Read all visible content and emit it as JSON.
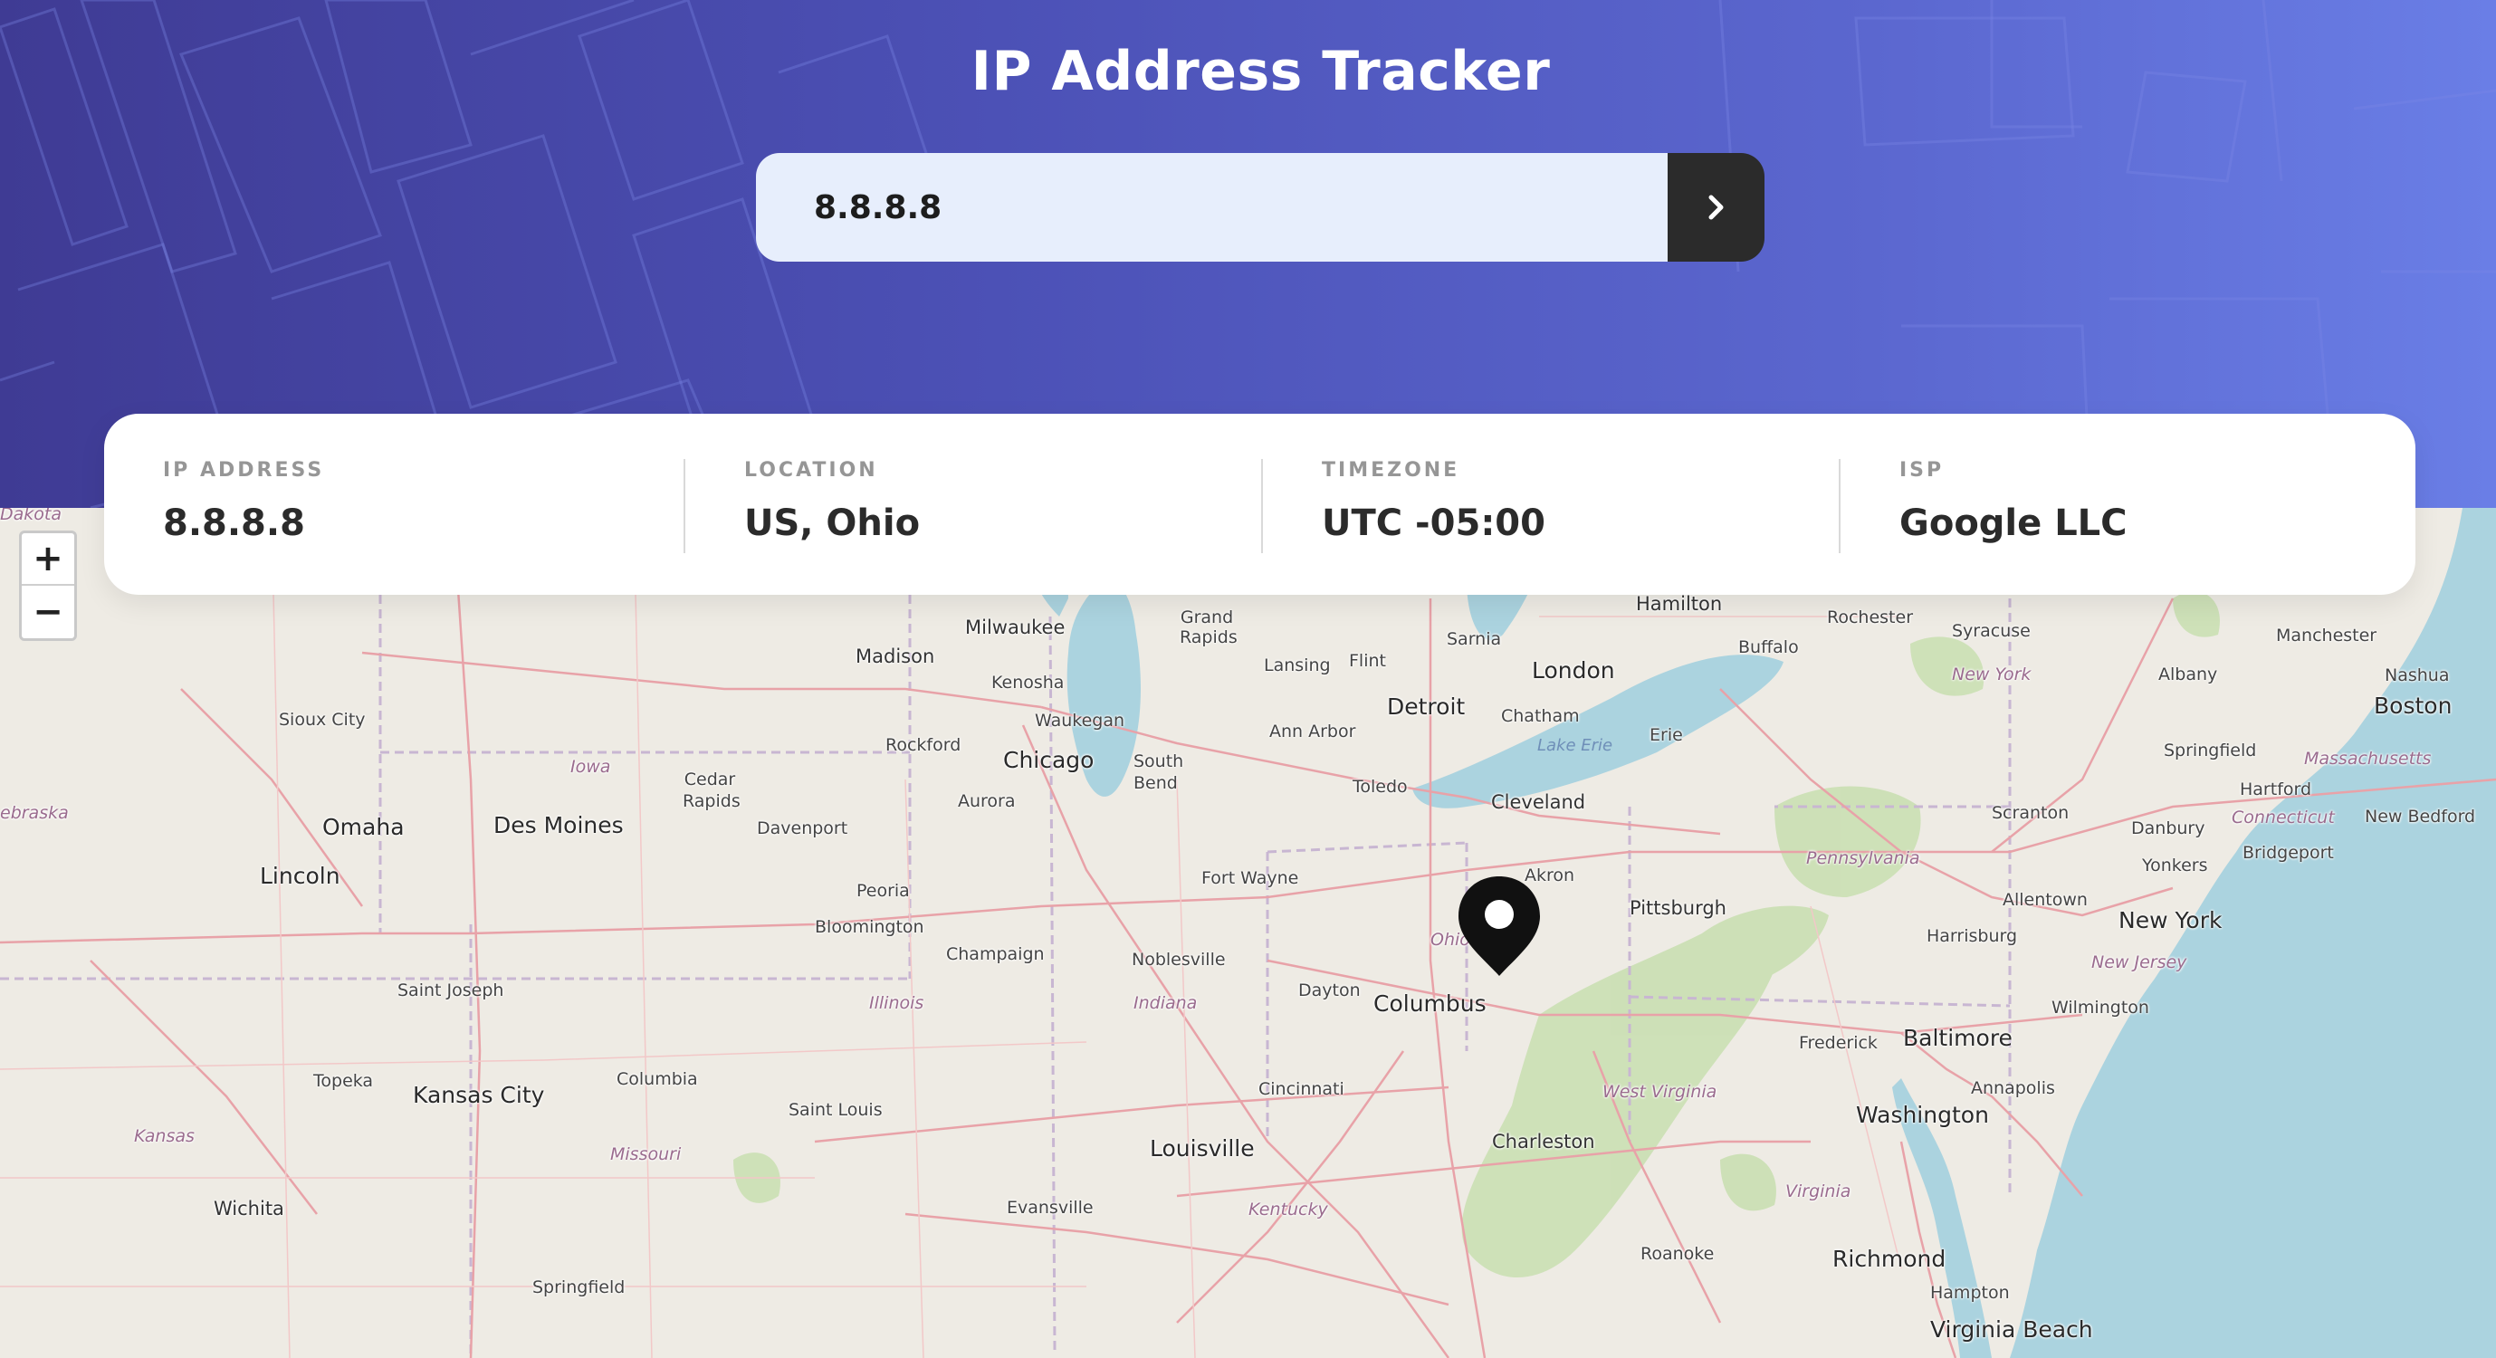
{
  "header": {
    "title": "IP Address Tracker"
  },
  "search": {
    "value": "8.8.8.8",
    "button_icon": "chevron-right-icon"
  },
  "info": {
    "ip_address": {
      "label": "IP ADDRESS",
      "value": "8.8.8.8"
    },
    "location": {
      "label": "LOCATION",
      "value": "US, Ohio"
    },
    "timezone": {
      "label": "TIMEZONE",
      "value": "UTC -05:00"
    },
    "isp": {
      "label": "ISP",
      "value": "Google LLC"
    }
  },
  "map": {
    "zoom_in": "+",
    "zoom_out": "−",
    "marker_icon": "location-pin-icon",
    "labels": {
      "dakota": "Dakota",
      "ebraska": "ebraska",
      "milwaukee": "Milwaukee",
      "grand_rapids": "Grand Rapids",
      "madison": "Madison",
      "kenosha": "Kenosha",
      "lansing": "Lansing",
      "flint": "Flint",
      "sarnia": "Sarnia",
      "hamilton": "Hamilton",
      "rochester": "Rochester",
      "syracuse": "Syracuse",
      "manchester": "Manchester",
      "buffalo": "Buffalo",
      "london": "London",
      "nashua": "Nashua",
      "new_york_state": "New York",
      "albany": "Albany",
      "boston": "Boston",
      "sioux_city": "Sioux City",
      "waukegan": "Waukegan",
      "detroit": "Detroit",
      "chatham": "Chatham",
      "rockford": "Rockford",
      "ann_arbor": "Ann Arbor",
      "lake_erie": "Lake Erie",
      "erie": "Erie",
      "iowa": "Iowa",
      "chicago": "Chicago",
      "south_bend": "South Bend",
      "cedar_rapids": "Cedar Rapids",
      "springfield_ma": "Springfield",
      "massachusetts": "Massachusetts",
      "toledo": "Toledo",
      "hartford": "Hartford",
      "aurora": "Aurora",
      "cleveland": "Cleveland",
      "omaha": "Omaha",
      "des_moines": "Des Moines",
      "davenport": "Davenport",
      "scranton": "Scranton",
      "connecticut": "Connecticut",
      "new_bedford": "New Bedford",
      "danbury": "Danbury",
      "pennsylvania": "Pennsylvania",
      "bridgeport": "Bridgeport",
      "yonkers": "Yonkers",
      "akron": "Akron",
      "lincoln": "Lincoln",
      "fort_wayne": "Fort Wayne",
      "peoria": "Peoria",
      "allentown": "Allentown",
      "pittsburgh": "Pittsburgh",
      "new_york": "New York",
      "bloomington": "Bloomington",
      "ohio": "Ohio",
      "harrisburg": "Harrisburg",
      "champaign": "Champaign",
      "noblesville": "Noblesville",
      "new_jersey": "New Jersey",
      "saint_joseph": "Saint Joseph",
      "dayton": "Dayton",
      "columbus": "Columbus",
      "illinois": "Illinois",
      "indiana": "Indiana",
      "wilmington": "Wilmington",
      "frederick": "Frederick",
      "baltimore": "Baltimore",
      "topeka": "Topeka",
      "columbia": "Columbia",
      "kansas_city": "Kansas City",
      "cincinnati": "Cincinnati",
      "annapolis": "Annapolis",
      "west_virginia": "West Virginia",
      "saint_louis": "Saint Louis",
      "washington": "Washington",
      "kansas": "Kansas",
      "charleston": "Charleston",
      "louisville": "Louisville",
      "missouri": "Missouri",
      "virginia": "Virginia",
      "wichita": "Wichita",
      "evansville": "Evansville",
      "kentucky": "Kentucky",
      "roanoke": "Roanoke",
      "richmond": "Richmond",
      "springfield_mo": "Springfield",
      "hampton": "Hampton",
      "virginia_beach": "Virginia Beach"
    }
  }
}
